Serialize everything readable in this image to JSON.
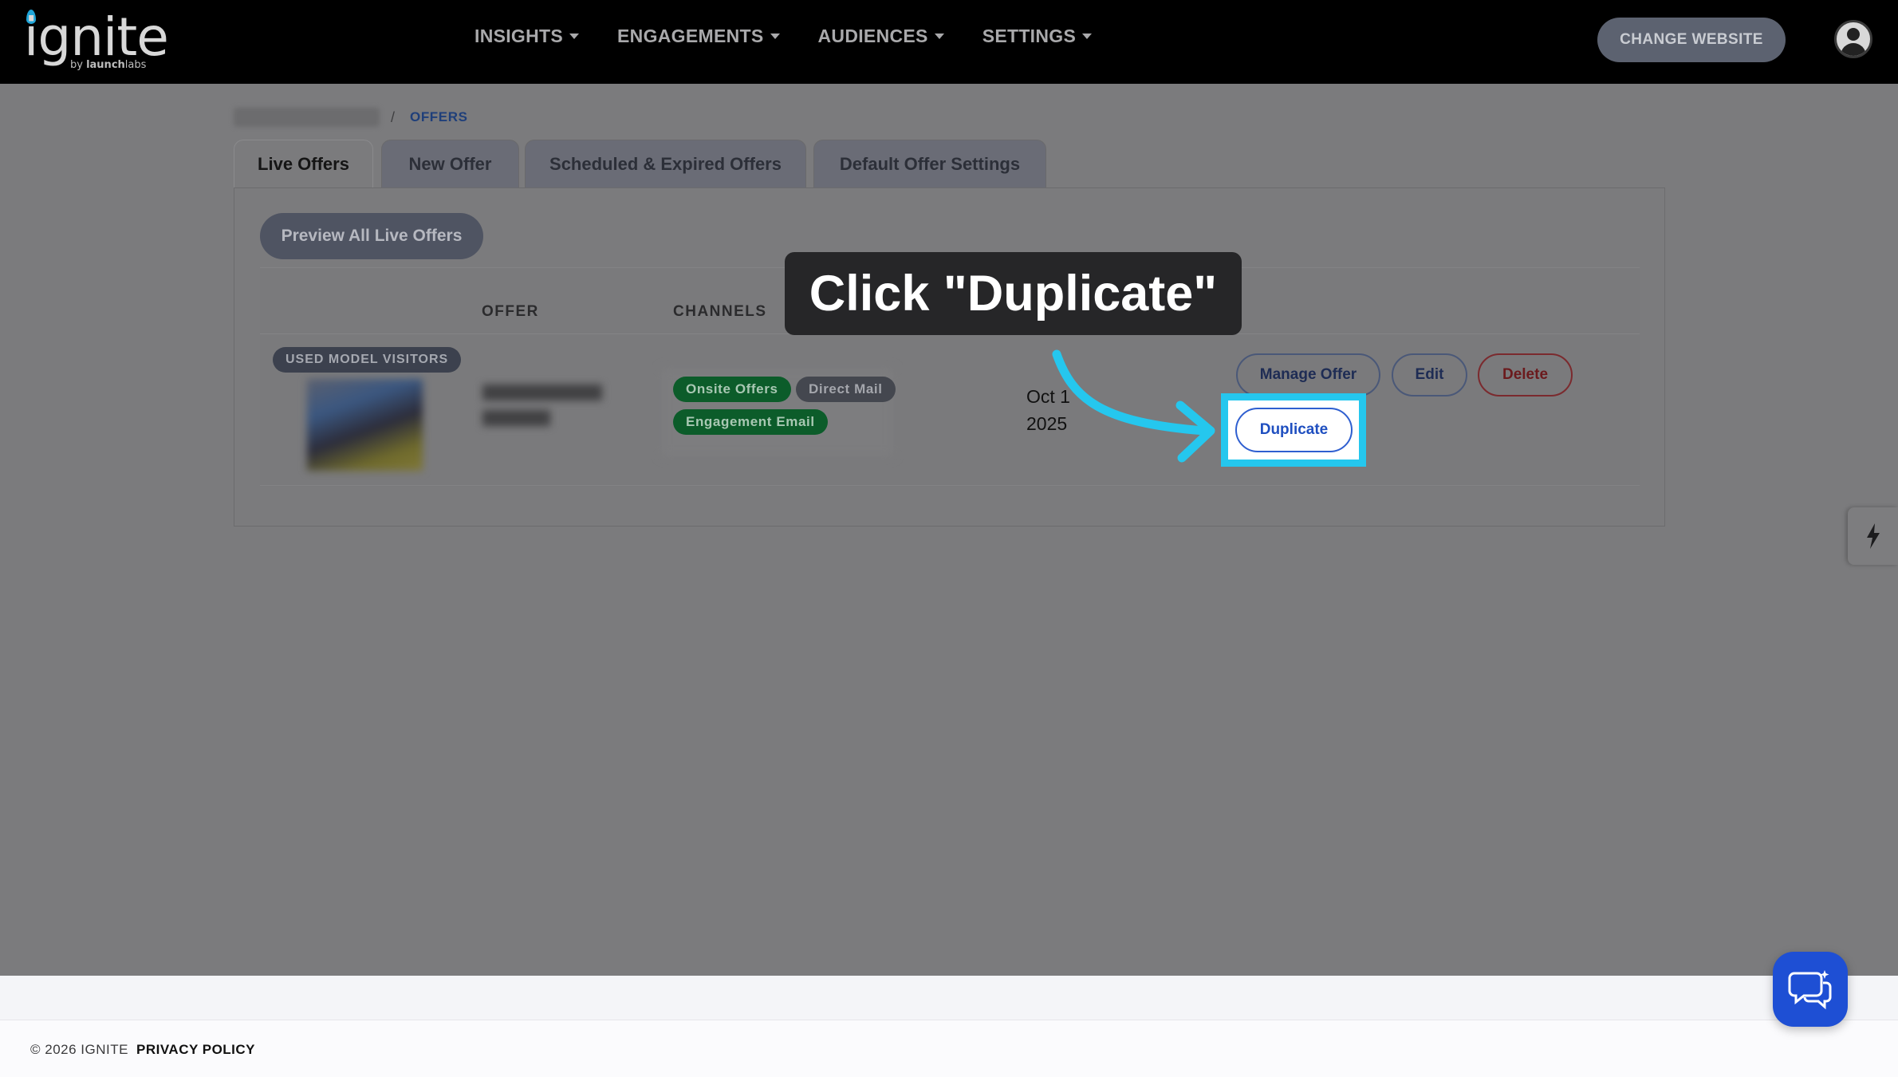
{
  "header": {
    "logo_word": "ignite",
    "logo_sub_by": "by ",
    "logo_sub_brand": "launch",
    "logo_sub_rest": "labs",
    "nav": [
      {
        "label": "INSIGHTS"
      },
      {
        "label": "ENGAGEMENTS"
      },
      {
        "label": "AUDIENCES"
      },
      {
        "label": "SETTINGS"
      }
    ],
    "change_website_label": "CHANGE WEBSITE"
  },
  "breadcrumb": {
    "separator": "/",
    "current": "OFFERS"
  },
  "tabs": [
    {
      "label": "Live Offers",
      "active": true
    },
    {
      "label": "New Offer",
      "active": false
    },
    {
      "label": "Scheduled & Expired Offers",
      "active": false
    },
    {
      "label": "Default Offer Settings",
      "active": false
    }
  ],
  "preview_button_label": "Preview All Live Offers",
  "table": {
    "headers": {
      "offer": "OFFER",
      "channels": "CHANNELS"
    },
    "row": {
      "audience": "USED MODEL VISITORS",
      "channels": [
        "Onsite Offers",
        "Direct Mail",
        "Engagement Email"
      ],
      "date_line1": "Oct 1",
      "date_line2": "2025",
      "actions": {
        "manage": "Manage Offer",
        "edit": "Edit",
        "delete": "Delete",
        "duplicate": "Duplicate"
      }
    }
  },
  "callout_text": "Click \"Duplicate\"",
  "footer": {
    "copyright": "© 2026 IGNITE",
    "privacy": "PRIVACY POLICY"
  },
  "colors": {
    "highlight": "#25c7ee",
    "chat_button": "#1e4fd4",
    "primary_link": "#1f4fc0"
  },
  "icons": [
    "caret-down-icon",
    "avatar-icon",
    "bolt-icon",
    "chat-icon",
    "arrow-icon"
  ]
}
